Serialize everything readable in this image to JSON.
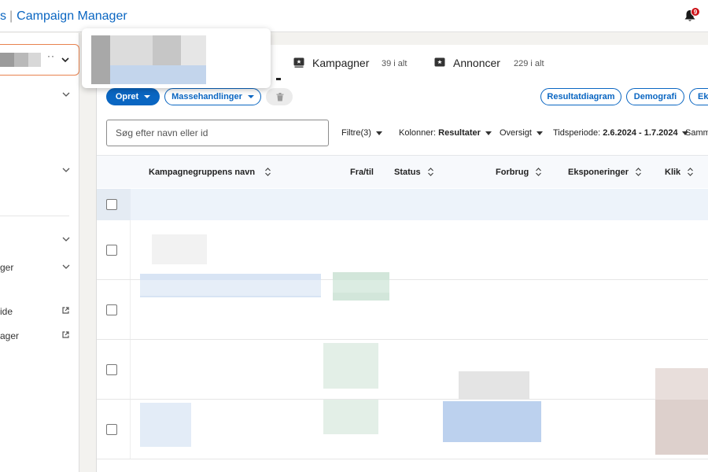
{
  "header": {
    "brand_prefix": "s",
    "brand_name": "Campaign Manager",
    "notification_count": "9"
  },
  "sidebar": {
    "account_select": {
      "masked_text": "··"
    },
    "items": [
      {
        "label": "ger"
      },
      {
        "label": "ide"
      },
      {
        "label": "ager"
      }
    ]
  },
  "main": {
    "tabs": [
      {
        "label": "Kampagner",
        "count": "39 i alt",
        "icon": "campaign-icon"
      },
      {
        "label": "Annoncer",
        "count": "229 i alt",
        "icon": "ad-icon"
      }
    ],
    "toolbar": {
      "create_label": "Opret",
      "bulk_label": "Massehandlinger",
      "delete_icon": "trash-icon",
      "result_chart_label": "Resultatdiagram",
      "demographics_label": "Demografi",
      "export_label": "Eks"
    },
    "search": {
      "placeholder": "Søg efter navn eller id"
    },
    "filters": {
      "filters_label": "Filtre(3)",
      "columns_label": "Kolonner:",
      "columns_value": "Resultater",
      "overview_label": "Oversigt",
      "period_label": "Tidsperiode:",
      "period_value": "2.6.2024 - 1.7.2024",
      "compare_label": "Samme"
    },
    "table": {
      "columns": [
        "Kampagnegruppens navn",
        "Fra/til",
        "Status",
        "Forbrug",
        "Eksponeringer",
        "Klik"
      ]
    }
  },
  "colors": {
    "brand_blue": "#0a66c2",
    "account_border": "#e8824f",
    "notification_red": "#cc1016"
  }
}
